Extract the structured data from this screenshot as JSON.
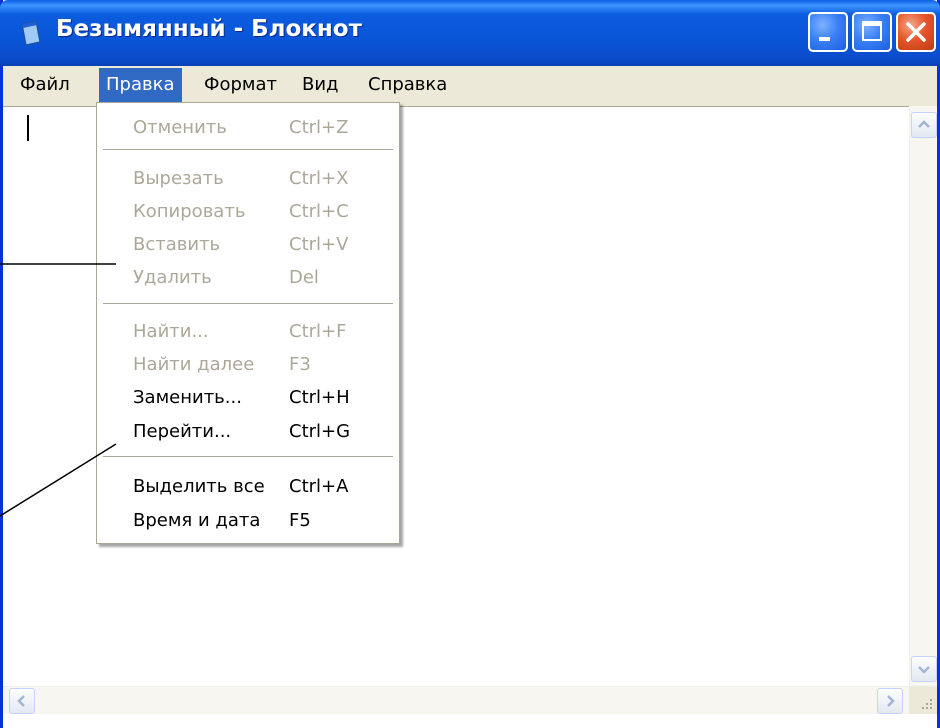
{
  "window": {
    "title": "Безымянный - Блокнот",
    "icon": "notepad-icon",
    "controls": [
      "minimize-icon",
      "maximize-icon",
      "close-icon"
    ]
  },
  "menubar": {
    "items": [
      {
        "label": "Файл"
      },
      {
        "label": "Правка"
      },
      {
        "label": "Формат"
      },
      {
        "label": "Вид"
      },
      {
        "label": "Справка"
      }
    ],
    "active": "Правка"
  },
  "edit_menu": {
    "items": [
      {
        "label": "Отменить",
        "shortcut": "Ctrl+Z",
        "enabled": false
      },
      {
        "label": "Вырезать",
        "shortcut": "Ctrl+X",
        "enabled": false
      },
      {
        "label": "Копировать",
        "shortcut": "Ctrl+C",
        "enabled": false
      },
      {
        "label": "Вставить",
        "shortcut": "Ctrl+V",
        "enabled": false
      },
      {
        "label": "Удалить",
        "shortcut": "Del",
        "enabled": false
      },
      {
        "label": "Найти...",
        "shortcut": "Ctrl+F",
        "enabled": false
      },
      {
        "label": "Найти далее",
        "shortcut": "F3",
        "enabled": false
      },
      {
        "label": "Заменить...",
        "shortcut": "Ctrl+H",
        "enabled": true
      },
      {
        "label": "Перейти...",
        "shortcut": "Ctrl+G",
        "enabled": true
      },
      {
        "label": "Выделить все",
        "shortcut": "Ctrl+A",
        "enabled": true
      },
      {
        "label": "Время и дата",
        "shortcut": "F5",
        "enabled": true
      }
    ]
  },
  "colors": {
    "title_bar": "#0a55d8",
    "menu_highlight": "#316ac5",
    "disabled_text": "#aca899",
    "window_border": "#0831d9"
  }
}
